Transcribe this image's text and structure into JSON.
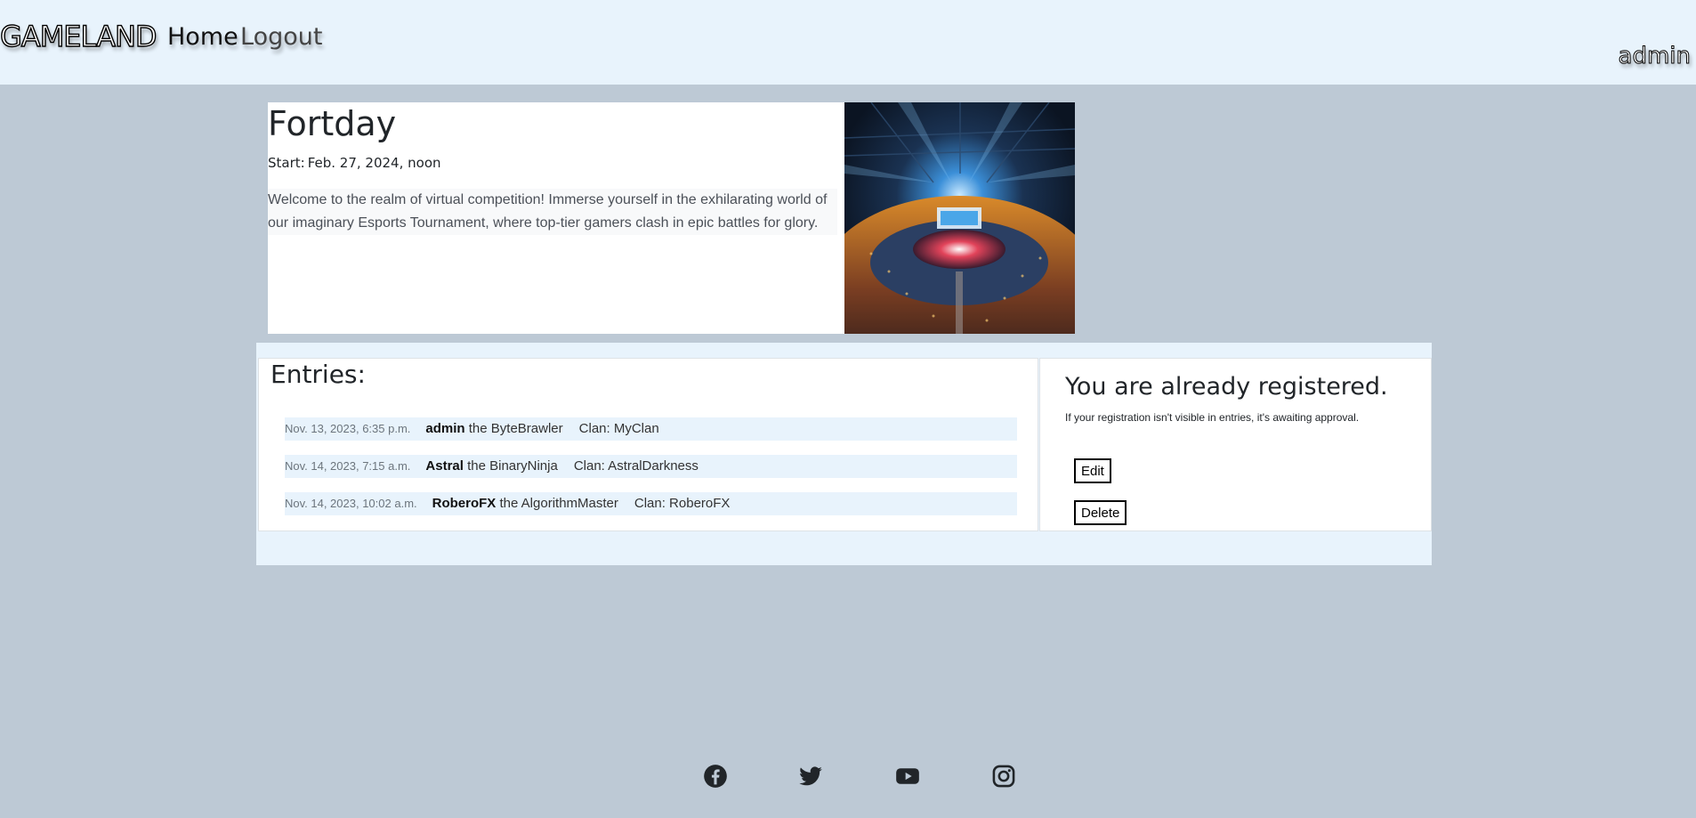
{
  "header": {
    "brand": "GAMELAND",
    "nav": [
      {
        "label": "Home"
      },
      {
        "label": "Logout"
      }
    ],
    "user": "admin"
  },
  "tournament": {
    "title": "Fortday",
    "start_label": "Start:",
    "start_value": "Feb. 27, 2024, noon",
    "description": "Welcome to the realm of virtual competition! Immerse yourself in the exhilarating world of our imaginary Esports Tournament, where top-tier gamers clash in epic battles for glory."
  },
  "entries": {
    "title": "Entries:",
    "items": [
      {
        "date": "Nov. 13, 2023, 6:35 p.m.",
        "user": "admin",
        "class": "the ByteBrawler",
        "clan": "Clan: MyClan"
      },
      {
        "date": "Nov. 14, 2023, 7:15 a.m.",
        "user": "Astral",
        "class": "the BinaryNinja",
        "clan": "Clan: AstralDarkness"
      },
      {
        "date": "Nov. 14, 2023, 10:02 a.m.",
        "user": "RoberoFX",
        "class": "the AlgorithmMaster",
        "clan": "Clan: RoberoFX"
      }
    ]
  },
  "registration": {
    "title": "You are already registered.",
    "note": "If your registration isn't visible in entries, it's awaiting approval.",
    "edit_label": "Edit",
    "delete_label": "Delete"
  },
  "footer": {
    "social": [
      {
        "icon": "facebook-icon"
      },
      {
        "icon": "twitter-icon"
      },
      {
        "icon": "youtube-icon"
      },
      {
        "icon": "instagram-icon"
      }
    ]
  },
  "colors": {
    "page_bg": "#bdc9d5",
    "header_bg": "#e8f3fc",
    "row_bg": "#e8f3fc"
  }
}
